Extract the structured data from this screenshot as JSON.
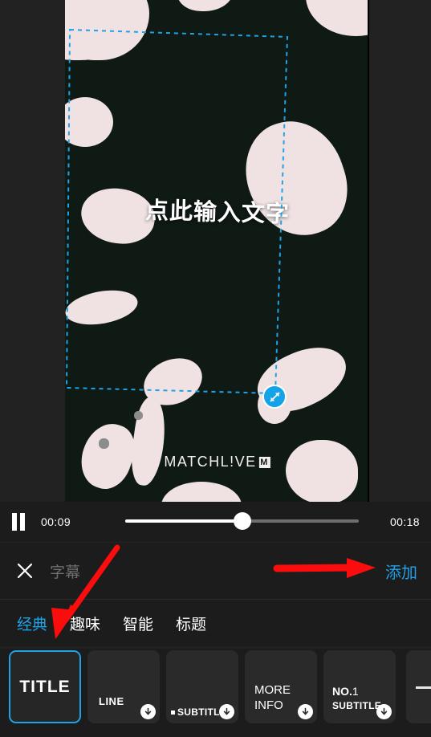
{
  "app": {
    "name": "video-subtitle-editor"
  },
  "preview": {
    "text_overlay": "点此输入文字",
    "watermark": "MATCHL!VE",
    "watermark_badge": "M",
    "background_color": "#0f1a15",
    "blob_color": "#f0e2e2",
    "selection_color": "#1fa2e8",
    "handle_icon": "resize-diagonal-icon"
  },
  "playback": {
    "state_icon": "pause-icon",
    "current_time": "00:09",
    "total_time": "00:18",
    "progress_percent": 50
  },
  "action_row": {
    "close_icon": "close-icon",
    "subtitle_placeholder": "字幕",
    "subtitle_value": "",
    "add_label": "添加",
    "add_color": "#1fa2e8"
  },
  "tabs": [
    {
      "label": "经典",
      "active": true
    },
    {
      "label": "趣味",
      "active": false
    },
    {
      "label": "智能",
      "active": false
    },
    {
      "label": "标题",
      "active": false
    }
  ],
  "templates": [
    {
      "label": "TITLE",
      "selected": true,
      "download": false
    },
    {
      "label": "LINE",
      "selected": false,
      "download": true
    },
    {
      "label": "▪SUBTITLE",
      "selected": false,
      "download": true
    },
    {
      "label": "MORE\nINFO",
      "selected": false,
      "download": true
    },
    {
      "label": "NO.1",
      "sublabel": "SUBTITLE",
      "selected": false,
      "download": true
    },
    {
      "label": "",
      "selected": false,
      "download": false
    }
  ],
  "template_labels": {
    "t0": "TITLE",
    "t1": "LINE",
    "t2": "SUBTITLE",
    "t3_line1": "MORE",
    "t3_line2": "INFO",
    "t4_line1a": "NO.",
    "t4_line1b": "1",
    "t4_line2": "SUBTITLE"
  },
  "annotations": {
    "arrow_color": "#fc0d0d",
    "arrow_to_add_button": "horizontal-right-arrow",
    "arrow_to_classic_tab": "diagonal-down-left-arrow"
  }
}
